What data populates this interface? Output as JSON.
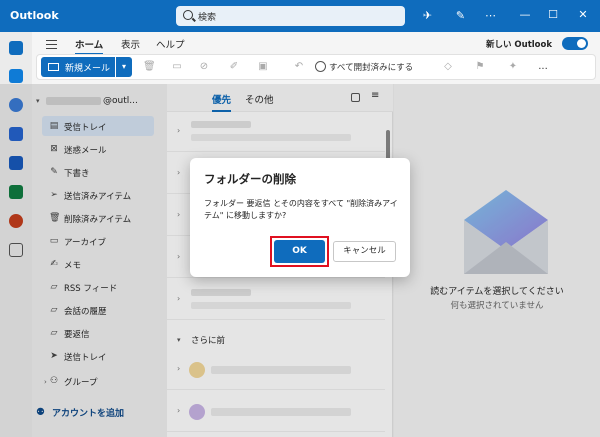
{
  "app": {
    "title": "Outlook"
  },
  "search": {
    "placeholder": "検索"
  },
  "ribbon": {
    "tabs": [
      {
        "label": "ホーム"
      },
      {
        "label": "表示"
      },
      {
        "label": "ヘルプ"
      }
    ],
    "new_outlook_label": "新しい Outlook",
    "new_mail_label": "新規メール",
    "mark_all_read_label": "すべて開封済みにする",
    "more_label": "..."
  },
  "account": {
    "name_suffix": "@outl..."
  },
  "folders": [
    {
      "label": "受信トレイ",
      "icon": "inbox-icon",
      "selected": true
    },
    {
      "label": "迷惑メール",
      "icon": "junk-icon"
    },
    {
      "label": "下書き",
      "icon": "drafts-icon"
    },
    {
      "label": "送信済みアイテム",
      "icon": "sent-icon"
    },
    {
      "label": "削除済みアイテム",
      "icon": "trash-icon"
    },
    {
      "label": "アーカイブ",
      "icon": "archive-icon"
    },
    {
      "label": "メモ",
      "icon": "notes-icon"
    },
    {
      "label": "RSS フィード",
      "icon": "folder-icon"
    },
    {
      "label": "会話の履歴",
      "icon": "folder-icon"
    },
    {
      "label": "要返信",
      "icon": "folder-icon"
    },
    {
      "label": "送信トレイ",
      "icon": "outbox-icon"
    },
    {
      "label": "グループ",
      "icon": "group-icon"
    }
  ],
  "add_account_label": "アカウントを追加",
  "message_list": {
    "tabs": [
      {
        "label": "優先"
      },
      {
        "label": "その他"
      }
    ],
    "section_label": "さらに前"
  },
  "reading_pane": {
    "title": "読むアイテムを選択してください",
    "subtitle": "何も選択されていません"
  },
  "dialog": {
    "title": "フォルダーの削除",
    "message": "フォルダー 要返信 とその内容をすべて \"削除済みアイテム\" に移動しますか?",
    "ok_label": "OK",
    "cancel_label": "キャンセル"
  },
  "colors": {
    "accent": "#0f6cbd",
    "highlight_frame": "#e01020"
  }
}
